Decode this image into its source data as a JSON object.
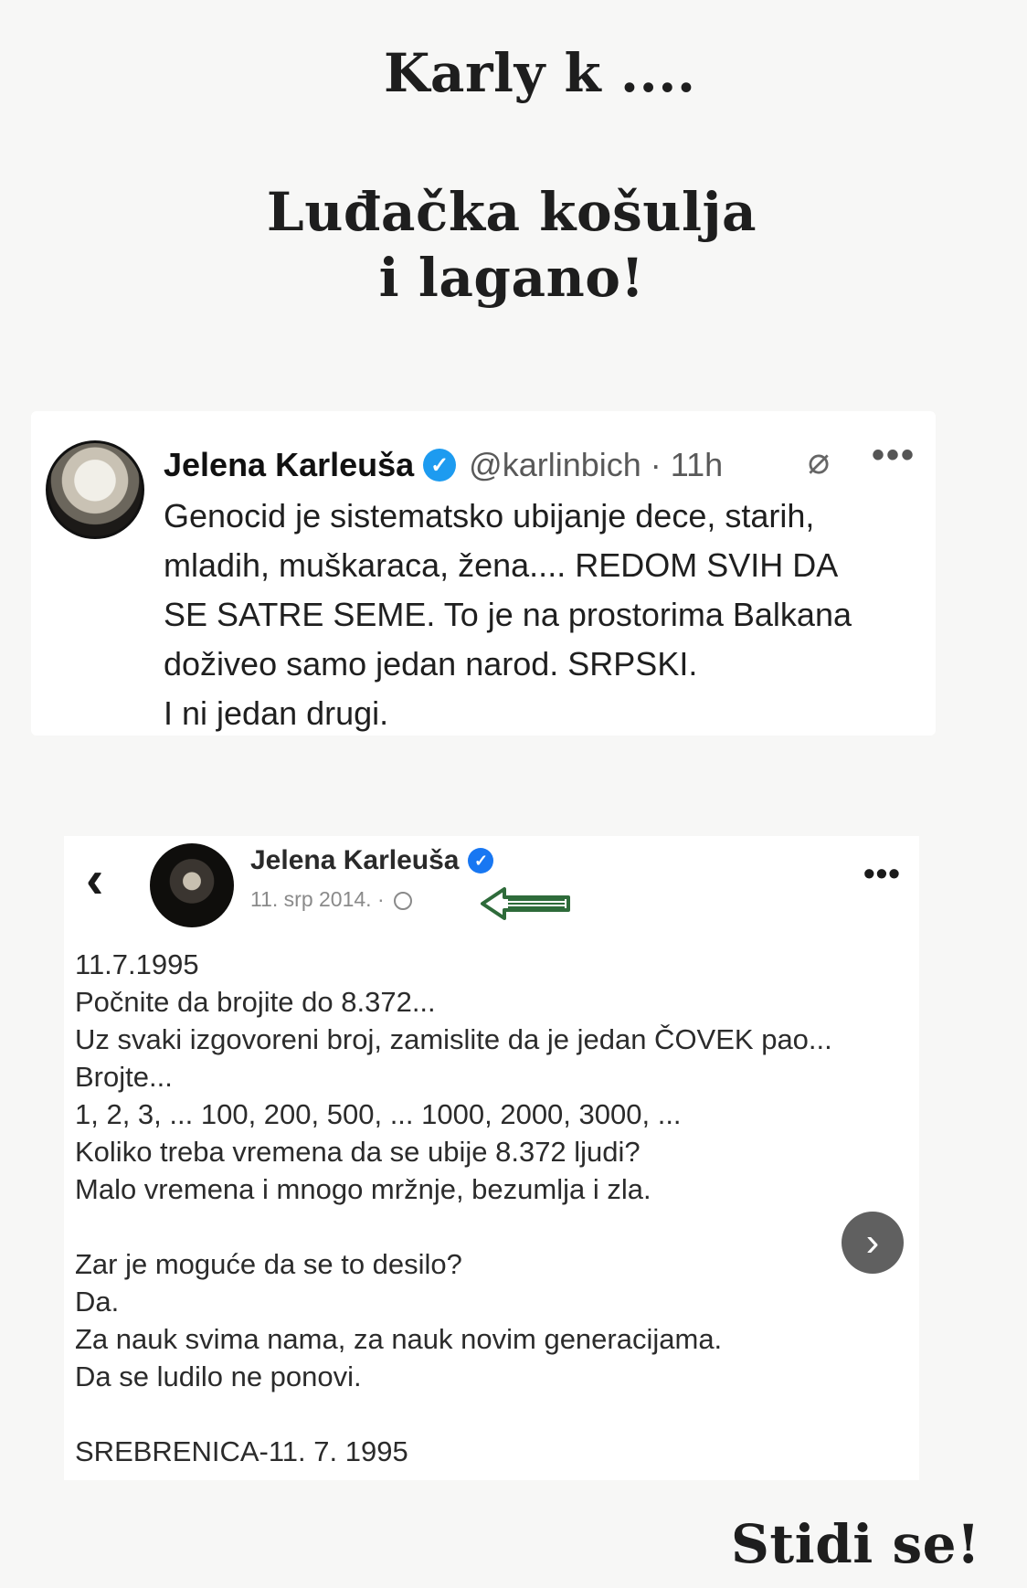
{
  "story": {
    "top_text": "Karly k ....",
    "middle_text_line1": "Luđačka košulja",
    "middle_text_line2": "i lagano!",
    "bottom_text": "Stidi se!"
  },
  "tweet": {
    "author_name": "Jelena Karleuša",
    "handle_time": "@karlinbich · 11h",
    "verified_icon": "verified-badge-icon",
    "lines": [
      "Genocid je sistematsko ubijanje dece, starih,",
      "mladih, muškaraca, žena.... REDOM SVIH DA",
      "SE SATRE SEME. To je na prostorima Balkana",
      "doživeo samo jedan narod. SRPSKI.",
      " I ni jedan drugi."
    ]
  },
  "fb_post": {
    "author_name": "Jelena Karleuša",
    "date": "11. srp 2014. ·",
    "lines": [
      "11.7.1995",
      "Počnite da brojite do 8.372...",
      "Uz svaki izgovoreni broj, zamislite da je jedan ČOVEK pao...",
      "Brojte...",
      "1, 2, 3, ... 100, 200, 500, ... 1000, 2000, 3000, ...",
      "Koliko treba vremena da se ubije 8.372 ljudi?",
      "Malo vremena i mnogo mržnje, bezumlja i zla.",
      "",
      "Zar je moguće da se to desilo?",
      "Da.",
      "Za nauk svima nama, za nauk novim generacijama.",
      "Da se ludilo ne ponovi.",
      "",
      "SREBRENICA-11. 7. 1995"
    ]
  },
  "icons": {
    "back": "‹",
    "more": "•••",
    "grok": "⌀",
    "next": "›",
    "check": "✓"
  },
  "colors": {
    "twitter_verified": "#1d9bf0",
    "facebook_verified": "#1877f2",
    "annotation_arrow": "#2e6b3a"
  }
}
